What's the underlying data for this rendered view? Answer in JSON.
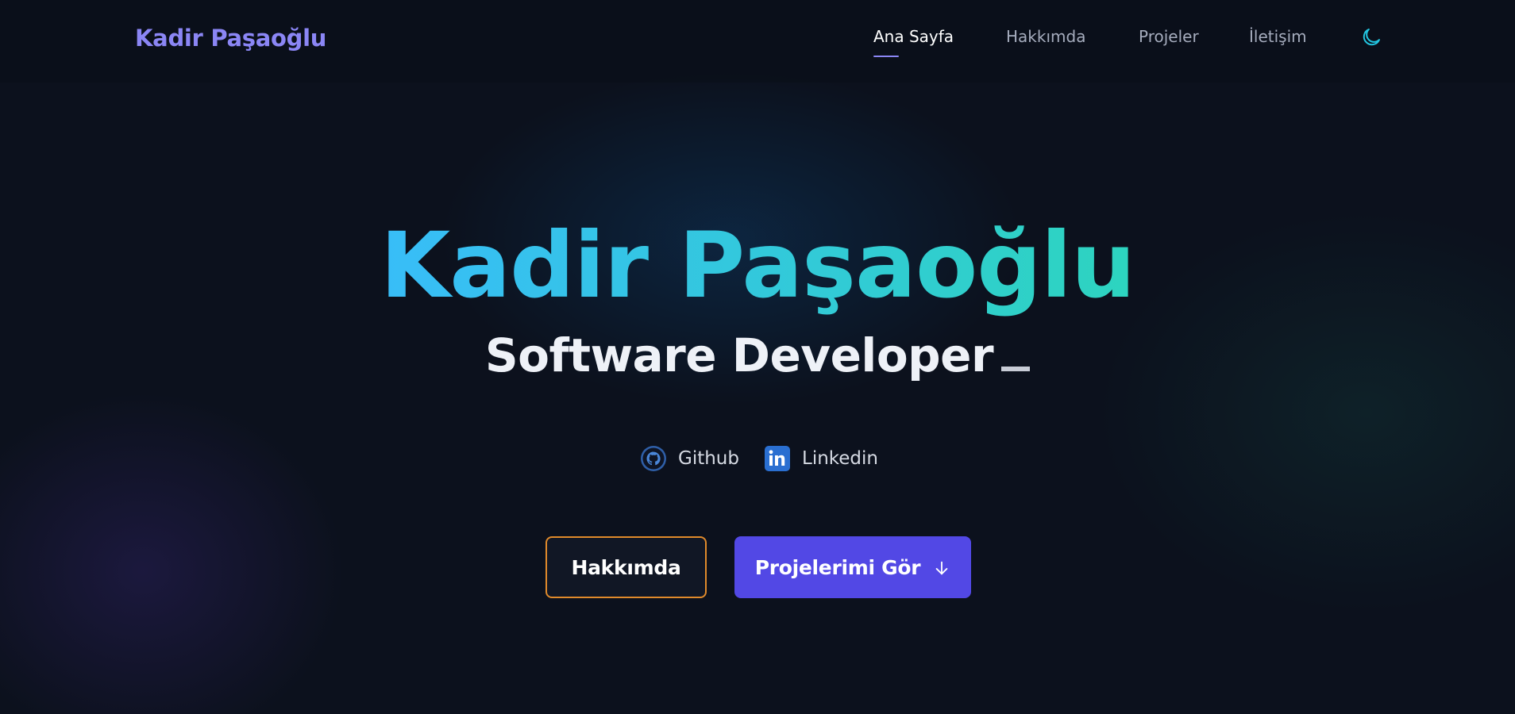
{
  "header": {
    "brand": "Kadir Paşaoğlu",
    "nav": [
      {
        "label": "Ana Sayfa",
        "active": true
      },
      {
        "label": "Hakkımda",
        "active": false
      },
      {
        "label": "Projeler",
        "active": false
      },
      {
        "label": "İletişim",
        "active": false
      }
    ],
    "theme_icon": "moon-icon"
  },
  "hero": {
    "title": "Kadir Paşaoğlu",
    "subtitle": "Software Developer",
    "socials": [
      {
        "label": "Github",
        "icon": "github-icon"
      },
      {
        "label": "Linkedin",
        "icon": "linkedin-icon"
      }
    ],
    "buttons": {
      "about": "Hakkımda",
      "projects": "Projelerimi Gör",
      "projects_icon": "arrow-down-icon"
    }
  },
  "colors": {
    "background": "#0c111d",
    "brand": "#8b86f5",
    "gradient_start": "#38bdf8",
    "gradient_end": "#2dd4bf",
    "primary_button": "#5248e5",
    "outline_button_border": "#e08a2b",
    "theme_icon": "#22c5e0"
  }
}
